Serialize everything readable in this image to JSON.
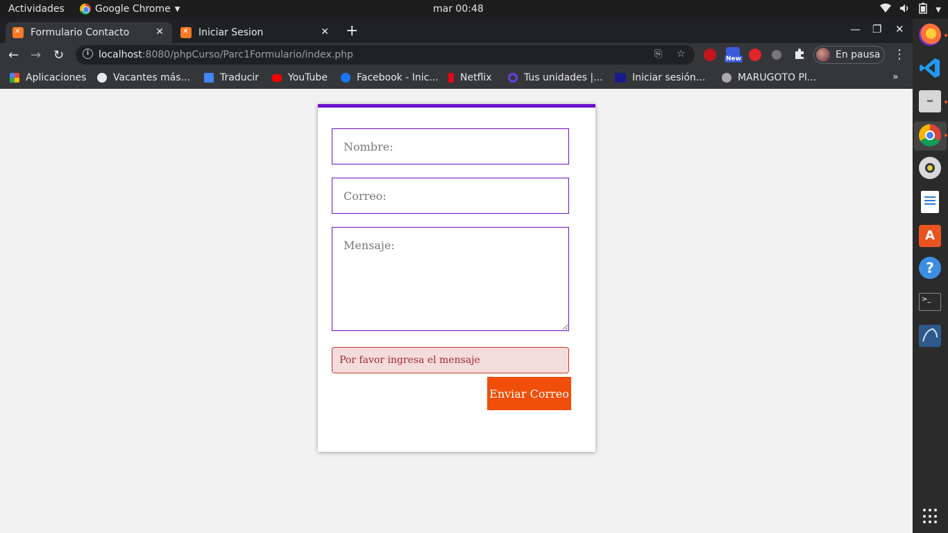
{
  "system_bar": {
    "activities": "Actividades",
    "app_name": "Google Chrome",
    "clock": "mar 00:48"
  },
  "tabs": [
    {
      "title": "Formulario Contacto",
      "active": true
    },
    {
      "title": "Iniciar Sesion",
      "active": false
    }
  ],
  "address_bar": {
    "host": "localhost",
    "path": ":8080/phpCurso/Parc1Formulario/index.php"
  },
  "extensions": {
    "new_badge": "New"
  },
  "profile": {
    "label": "En pausa"
  },
  "bookmarks": [
    {
      "label": "Aplicaciones",
      "icon": "apps-grid-icon",
      "color": "#4285f4"
    },
    {
      "label": "Vacantes más...",
      "icon": "globe-icon",
      "color": "#e8eaed"
    },
    {
      "label": "Traducir",
      "icon": "google-translate-icon",
      "color": "#4285f4"
    },
    {
      "label": "YouTube",
      "icon": "youtube-icon",
      "color": "#ff0000"
    },
    {
      "label": "Facebook - Inic...",
      "icon": "facebook-icon",
      "color": "#1877f2"
    },
    {
      "label": "Netflix",
      "icon": "netflix-icon",
      "color": "#e50914"
    },
    {
      "label": "Tus unidades |...",
      "icon": "quizlet-icon",
      "color": "#4257b2"
    },
    {
      "label": "Iniciar sesión...",
      "icon": "oup-icon",
      "color": "#1a1a8c"
    },
    {
      "label": "MARUGOTO Pl...",
      "icon": "marugoto-icon",
      "color": "#aaaaaa"
    }
  ],
  "form": {
    "name_placeholder": "Nombre:",
    "email_placeholder": "Correo:",
    "message_placeholder": "Mensaje:",
    "error_message": "Por favor ingresa el mensaje",
    "submit_label": "Enviar Correo",
    "accent_color": "#6a0dcc",
    "button_color": "#f04e0a"
  },
  "dock": [
    {
      "name": "firefox-icon",
      "color": "#ff7139"
    },
    {
      "name": "vscode-icon",
      "color": "#0078d4"
    },
    {
      "name": "files-icon",
      "color": "#cccccc"
    },
    {
      "name": "chrome-icon",
      "color": "#4285f4"
    },
    {
      "name": "rhythmbox-icon",
      "color": "#e8c84a"
    },
    {
      "name": "writer-icon",
      "color": "#2a7ad5"
    },
    {
      "name": "software-center-icon",
      "color": "#e95420"
    },
    {
      "name": "help-icon",
      "color": "#3d8ee0"
    },
    {
      "name": "terminal-icon",
      "color": "#2c2c2c"
    },
    {
      "name": "mysql-workbench-icon",
      "color": "#2d5a8a"
    }
  ]
}
